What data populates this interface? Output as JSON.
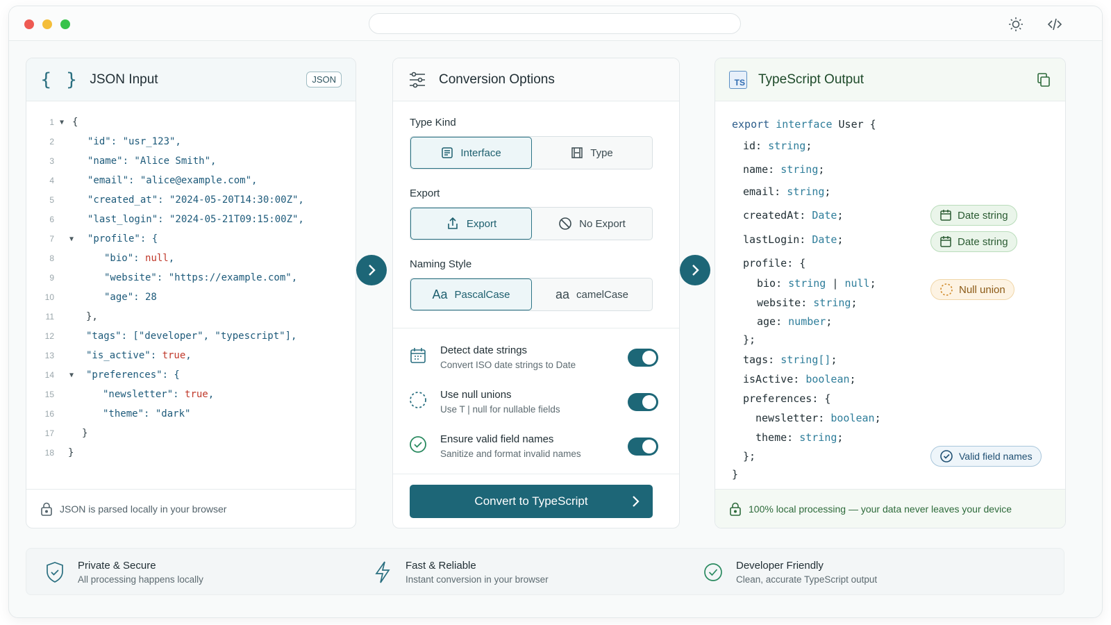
{
  "json_panel": {
    "title": "JSON Input",
    "badge": "JSON",
    "lines": [
      {
        "n": "1",
        "text": "{"
      },
      {
        "n": "2",
        "text": "\"id\": \"usr_123\","
      },
      {
        "n": "3",
        "text": "\"name\": \"Alice Smith\","
      },
      {
        "n": "4",
        "text": "\"email\": \"alice@example.com\","
      },
      {
        "n": "5",
        "text": "\"created_at\": \"2024-05-20T14:30:00Z\","
      },
      {
        "n": "6",
        "text": "\"last_login\": \"2024-05-21T09:15:00Z\","
      },
      {
        "n": "7",
        "text": "\"profile\": {"
      },
      {
        "n": "8",
        "text": "\"bio\": null,"
      },
      {
        "n": "9",
        "text": "\"website\": \"https://example.com\","
      },
      {
        "n": "10",
        "text": "\"age\": 28"
      },
      {
        "n": "11",
        "text": "},"
      },
      {
        "n": "12",
        "text": "\"tags\": [\"developer\", \"typescript\"],"
      },
      {
        "n": "13",
        "text": "\"is_active\": true,"
      },
      {
        "n": "14",
        "text": "\"preferences\": {"
      },
      {
        "n": "15",
        "text": "\"newsletter\": true,"
      },
      {
        "n": "16",
        "text": "\"theme\": \"dark\""
      },
      {
        "n": "17",
        "text": "}"
      },
      {
        "n": "18",
        "text": "}"
      }
    ],
    "footer": "JSON is parsed locally in your browser"
  },
  "options_panel": {
    "title": "Conversion Options",
    "type_kind_label": "Type Kind",
    "type_kind_options": [
      "Interface",
      "Type"
    ],
    "export_label": "Export",
    "export_options": [
      "Export",
      "No Export"
    ],
    "naming_label": "Naming Style",
    "naming_options": [
      {
        "glyph": "Aa",
        "label": "PascalCase"
      },
      {
        "glyph": "aa",
        "label": "camelCase"
      }
    ],
    "toggles": [
      {
        "title": "Detect date strings",
        "sub": "Convert ISO date strings to Date",
        "on": true
      },
      {
        "title": "Use null unions",
        "sub": "Use T | null for nullable fields",
        "on": true
      },
      {
        "title": "Ensure valid field names",
        "sub": "Sanitize and format invalid names",
        "on": true
      }
    ],
    "convert_button": "Convert to TypeScript"
  },
  "ts_panel": {
    "title": "TypeScript Output",
    "ts_badge": "TS",
    "code": {
      "l1_kw1": "export",
      "l1_kw2": "interface",
      "l1_name": "User {",
      "id": "id:",
      "id_t": "string",
      "name": "name:",
      "name_t": "string",
      "email": "email:",
      "email_t": "string",
      "createdAt": "createdAt:",
      "createdAt_t": "Date",
      "lastLogin": "lastLogin:",
      "lastLogin_t": "Date",
      "profile": "profile: {",
      "bio": "bio:",
      "bio_t": "string",
      "bio_pipe": "|",
      "bio_null": "null",
      "website": "website:",
      "website_t": "string",
      "age": "age:",
      "age_t": "number",
      "close1": "};",
      "tags": "tags:",
      "tags_t": "string[]",
      "isActive": "isActive:",
      "isActive_t": "boolean",
      "preferences": "preferences: {",
      "newsletter": "newsletter:",
      "newsletter_t": "boolean",
      "theme": "theme:",
      "theme_t": "string",
      "close2": "};",
      "close3": "}"
    },
    "chips": {
      "date1": "Date string",
      "date2": "Date string",
      "null_union": "Null union",
      "valid": "Valid field names"
    },
    "footer": "100% local processing — your data never leaves your device"
  },
  "features": [
    {
      "title": "Private & Secure",
      "sub": "All processing happens locally",
      "icon": "shield-icon"
    },
    {
      "title": "Fast & Reliable",
      "sub": "Instant conversion in your browser",
      "icon": "lightning-icon"
    },
    {
      "title": "Developer Friendly",
      "sub": "Clean, accurate TypeScript output",
      "icon": "check-circle-icon"
    }
  ],
  "colors": {
    "accent": "#1d6677",
    "date_chip": "#eaf5ea",
    "null_chip": "#fdf3e3",
    "valid_chip": "#eef5fa"
  }
}
